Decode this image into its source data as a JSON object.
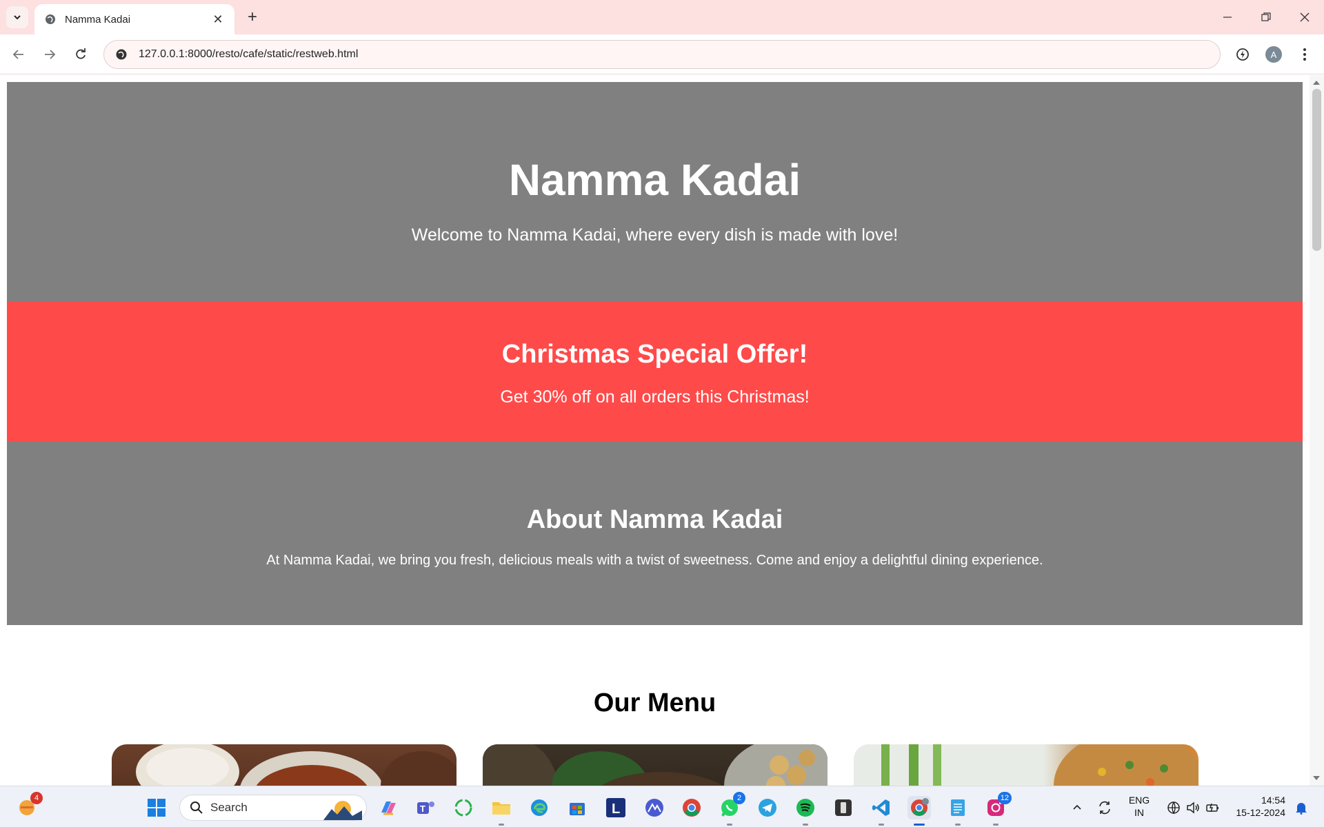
{
  "browser": {
    "tab_title": "Namma Kadai",
    "url": "127.0.0.1:8000/resto/cafe/static/restweb.html",
    "profile_initial": "A"
  },
  "hero": {
    "title": "Namma Kadai",
    "tagline": "Welcome to Namma Kadai, where every dish is made with love!"
  },
  "offer": {
    "title": "Christmas Special Offer!",
    "text": "Get 30% off on all orders this Christmas!"
  },
  "about": {
    "title": "About Namma Kadai",
    "text": "At Namma Kadai, we bring you fresh, delicious meals with a twist of sweetness. Come and enjoy a delightful dining experience."
  },
  "menu": {
    "title": "Our Menu"
  },
  "taskbar": {
    "weather_badge": "4",
    "search_placeholder": "Search",
    "whatsapp_badge": "2",
    "instagram_badge": "12",
    "language_line1": "ENG",
    "language_line2": "IN",
    "time": "14:54",
    "date": "15-12-2024"
  },
  "colors": {
    "hero_bg": "#808080",
    "offer_bg": "#ff4a4a",
    "tab_strip": "#fde0e0"
  }
}
